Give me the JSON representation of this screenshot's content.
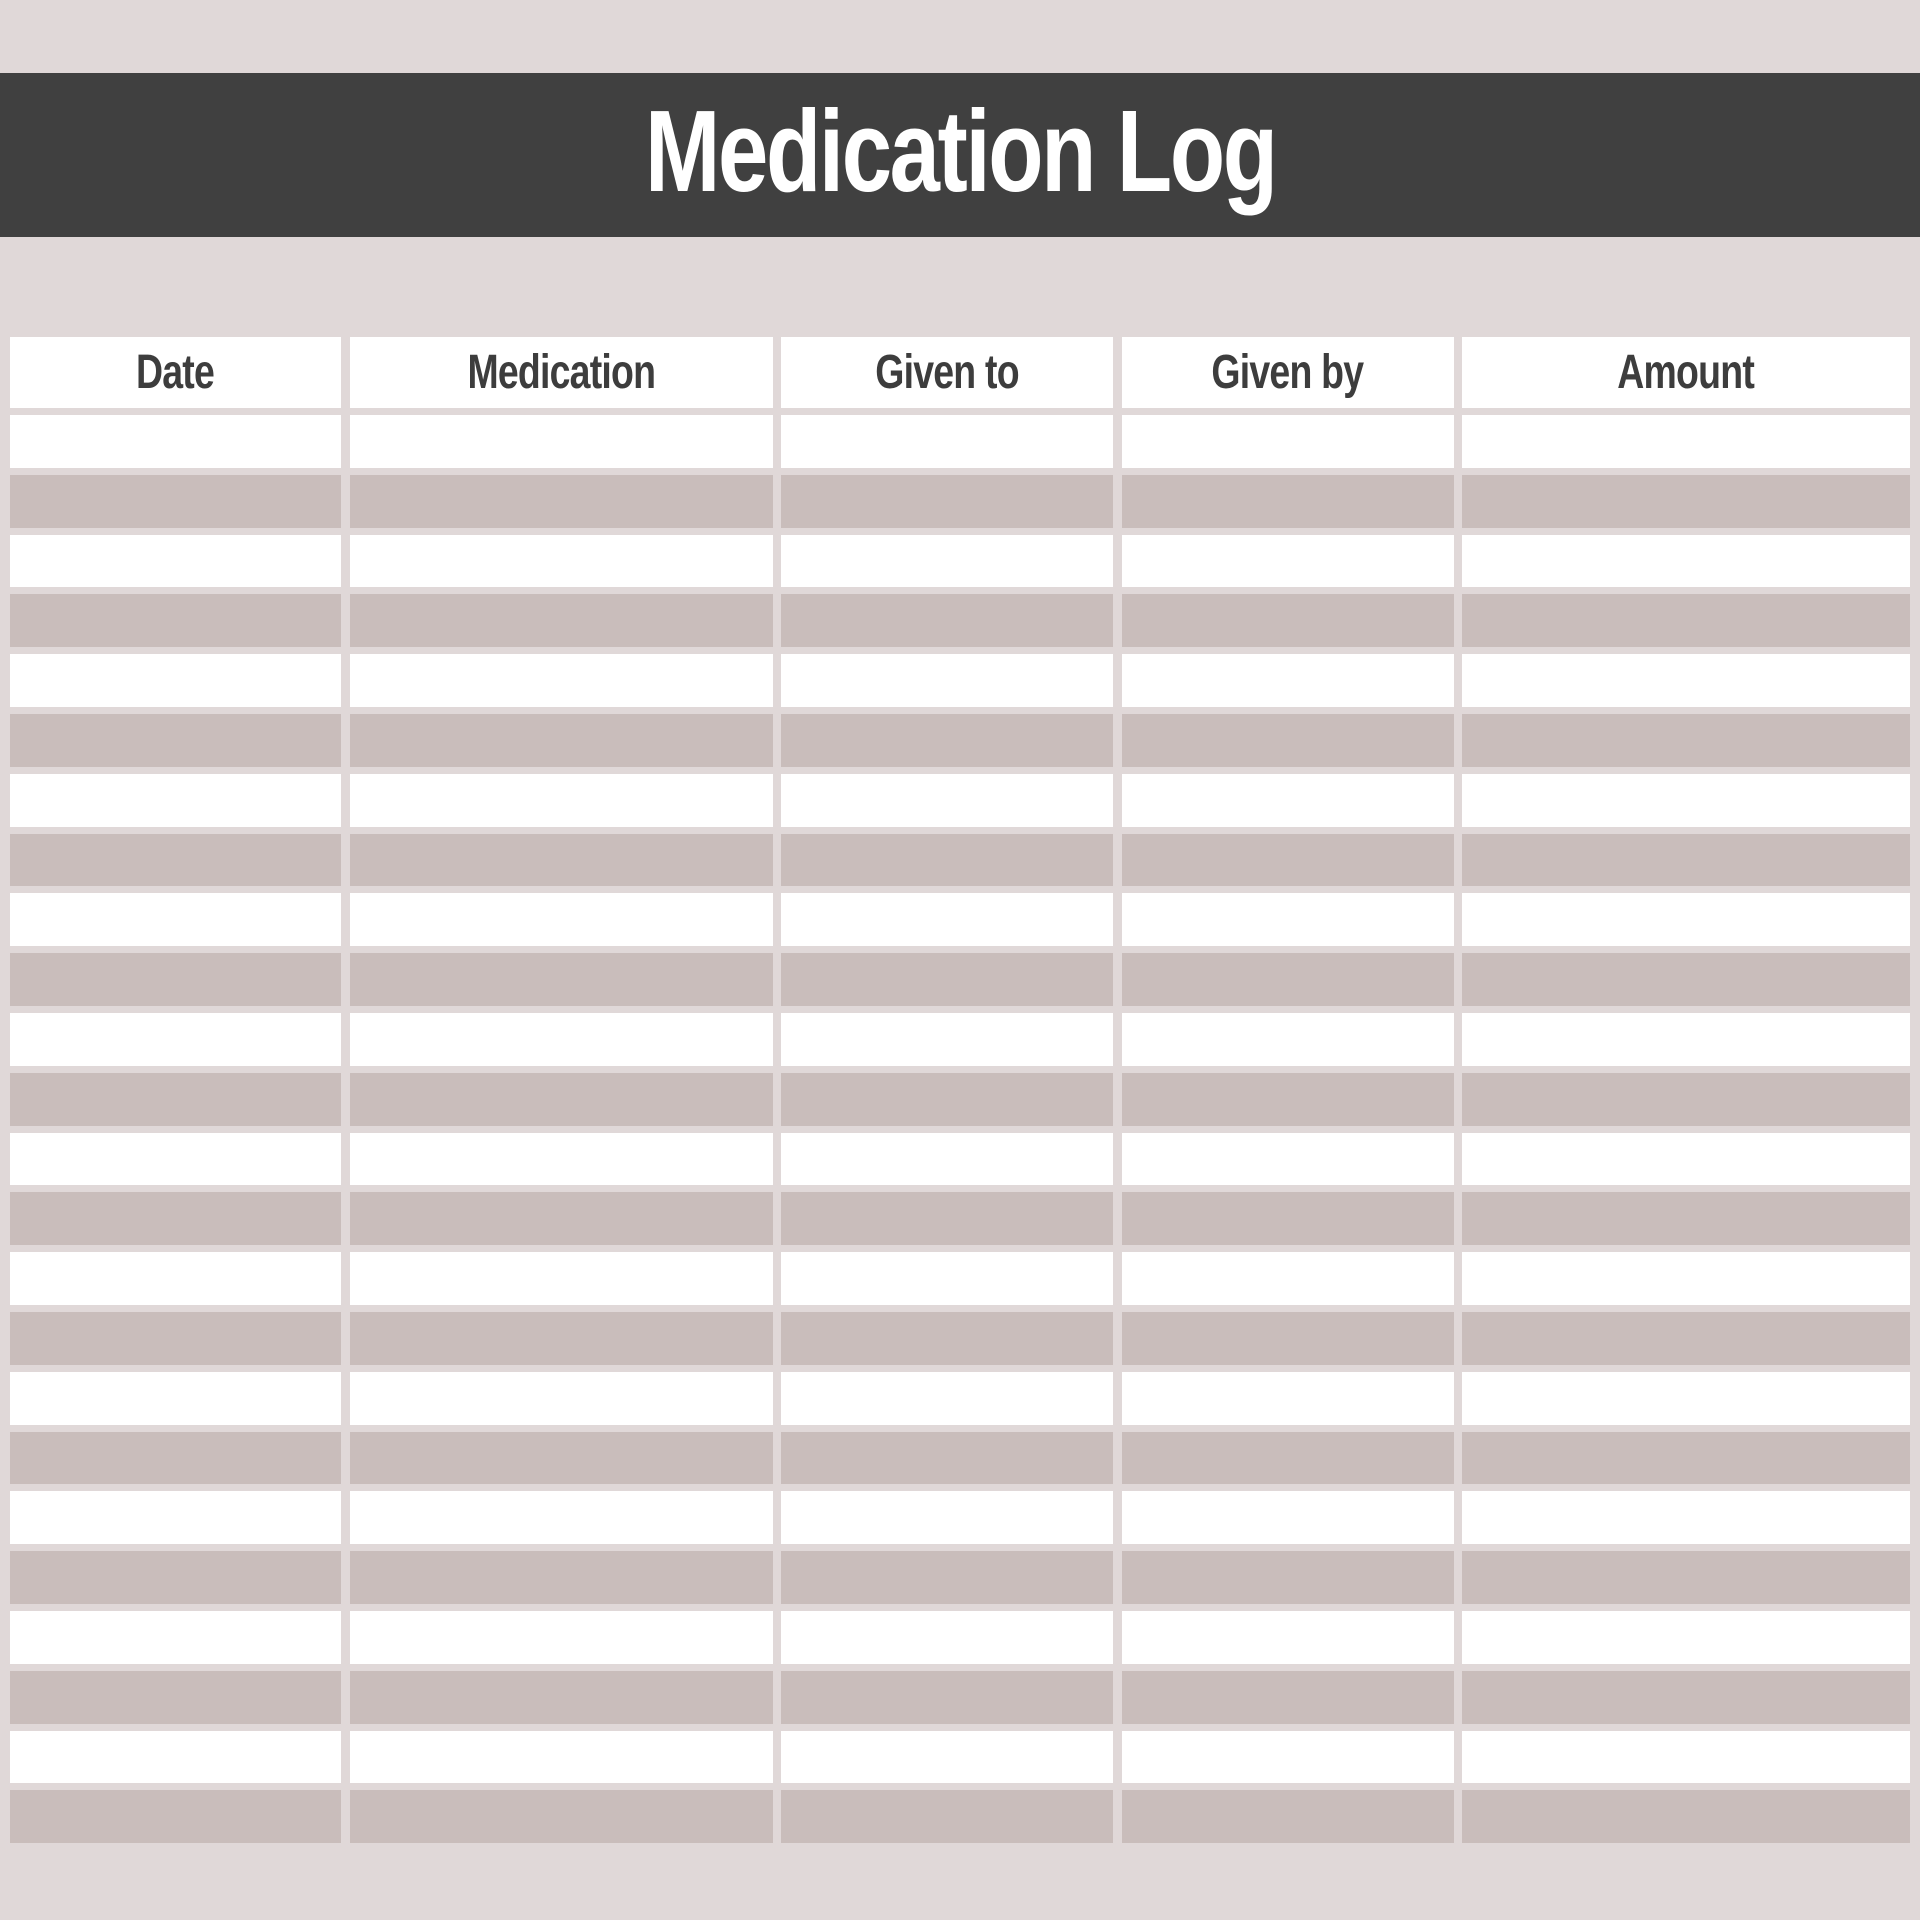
{
  "title": "Medication Log",
  "table": {
    "columns": [
      "Date",
      "Medication",
      "Given to",
      "Given by",
      "Amount"
    ],
    "row_count": 24,
    "rows": [
      [
        "",
        "",
        "",
        "",
        ""
      ],
      [
        "",
        "",
        "",
        "",
        ""
      ],
      [
        "",
        "",
        "",
        "",
        ""
      ],
      [
        "",
        "",
        "",
        "",
        ""
      ],
      [
        "",
        "",
        "",
        "",
        ""
      ],
      [
        "",
        "",
        "",
        "",
        ""
      ],
      [
        "",
        "",
        "",
        "",
        ""
      ],
      [
        "",
        "",
        "",
        "",
        ""
      ],
      [
        "",
        "",
        "",
        "",
        ""
      ],
      [
        "",
        "",
        "",
        "",
        ""
      ],
      [
        "",
        "",
        "",
        "",
        ""
      ],
      [
        "",
        "",
        "",
        "",
        ""
      ],
      [
        "",
        "",
        "",
        "",
        ""
      ],
      [
        "",
        "",
        "",
        "",
        ""
      ],
      [
        "",
        "",
        "",
        "",
        ""
      ],
      [
        "",
        "",
        "",
        "",
        ""
      ],
      [
        "",
        "",
        "",
        "",
        ""
      ],
      [
        "",
        "",
        "",
        "",
        ""
      ],
      [
        "",
        "",
        "",
        "",
        ""
      ],
      [
        "",
        "",
        "",
        "",
        ""
      ],
      [
        "",
        "",
        "",
        "",
        ""
      ],
      [
        "",
        "",
        "",
        "",
        ""
      ],
      [
        "",
        "",
        "",
        "",
        ""
      ],
      [
        "",
        "",
        "",
        "",
        ""
      ]
    ]
  },
  "colors": {
    "background": "#e0d8d8",
    "title_band": "#404040",
    "title_text": "#ffffff",
    "header_text": "#3d3d3d",
    "row_light": "#ffffff",
    "row_dark": "#c9bdbb"
  }
}
